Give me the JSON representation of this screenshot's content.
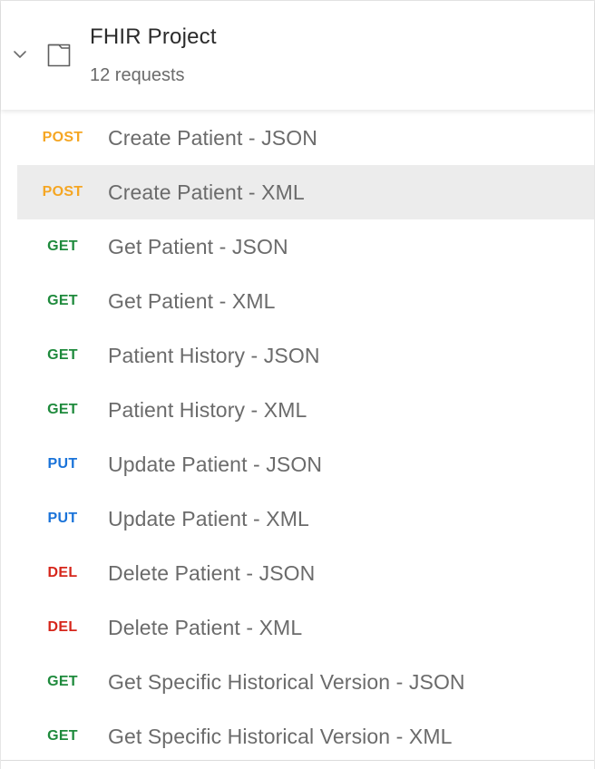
{
  "collection": {
    "title": "FHIR Project",
    "count_label": "12 requests",
    "icons": {
      "toggle": "chevron-down-icon",
      "folder": "folder-icon"
    }
  },
  "colors": {
    "POST": "#f5a623",
    "GET": "#1e8a3c",
    "PUT": "#1a73d9",
    "DEL": "#d6261b"
  },
  "requests": [
    {
      "method": "POST",
      "name": "Create Patient - JSON",
      "selected": false
    },
    {
      "method": "POST",
      "name": "Create Patient - XML",
      "selected": true
    },
    {
      "method": "GET",
      "name": "Get Patient - JSON",
      "selected": false
    },
    {
      "method": "GET",
      "name": "Get Patient - XML",
      "selected": false
    },
    {
      "method": "GET",
      "name": "Patient History - JSON",
      "selected": false
    },
    {
      "method": "GET",
      "name": "Patient History - XML",
      "selected": false
    },
    {
      "method": "PUT",
      "name": "Update Patient - JSON",
      "selected": false
    },
    {
      "method": "PUT",
      "name": "Update Patient - XML",
      "selected": false
    },
    {
      "method": "DEL",
      "name": "Delete Patient - JSON",
      "selected": false
    },
    {
      "method": "DEL",
      "name": "Delete Patient - XML",
      "selected": false
    },
    {
      "method": "GET",
      "name": "Get Specific Historical Version - JSON",
      "selected": false
    },
    {
      "method": "GET",
      "name": "Get Specific Historical Version - XML",
      "selected": false
    }
  ]
}
